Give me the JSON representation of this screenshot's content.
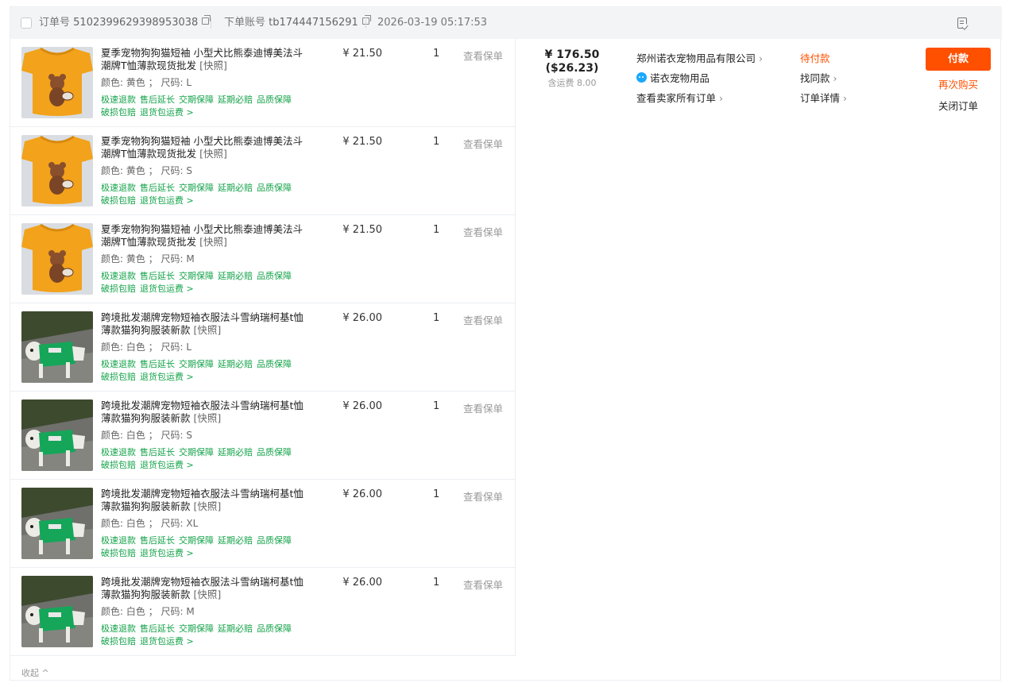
{
  "header": {
    "order_no_label": "订单号",
    "order_no": "5102399629398953038",
    "account_label": "下单账号",
    "account": "tb174447156291",
    "datetime": "2026-03-19 05:17:53"
  },
  "items": [
    {
      "title": "夏季宠物狗狗猫短袖 小型犬比熊泰迪博美法斗潮牌T恤薄款现货批发",
      "snapshot": "[快照]",
      "spec": "颜色: 黄色 ； 尺码: L",
      "price": "¥ 21.50",
      "qty": "1",
      "warranty": "查看保单",
      "image": "yellow-bear-shirt"
    },
    {
      "title": "夏季宠物狗狗猫短袖 小型犬比熊泰迪博美法斗潮牌T恤薄款现货批发",
      "snapshot": "[快照]",
      "spec": "颜色: 黄色 ； 尺码: S",
      "price": "¥ 21.50",
      "qty": "1",
      "warranty": "查看保单",
      "image": "yellow-bear-shirt"
    },
    {
      "title": "夏季宠物狗狗猫短袖 小型犬比熊泰迪博美法斗潮牌T恤薄款现货批发",
      "snapshot": "[快照]",
      "spec": "颜色: 黄色 ； 尺码: M",
      "price": "¥ 21.50",
      "qty": "1",
      "warranty": "查看保单",
      "image": "yellow-bear-shirt"
    },
    {
      "title": "跨境批发潮牌宠物短袖衣服法斗雪纳瑞柯基t恤薄款猫狗狗服装新款",
      "snapshot": "[快照]",
      "spec": "颜色: 白色 ； 尺码: L",
      "price": "¥ 26.00",
      "qty": "1",
      "warranty": "查看保单",
      "image": "dog-white-green-shirt"
    },
    {
      "title": "跨境批发潮牌宠物短袖衣服法斗雪纳瑞柯基t恤薄款猫狗狗服装新款",
      "snapshot": "[快照]",
      "spec": "颜色: 白色 ； 尺码: S",
      "price": "¥ 26.00",
      "qty": "1",
      "warranty": "查看保单",
      "image": "dog-white-green-shirt"
    },
    {
      "title": "跨境批发潮牌宠物短袖衣服法斗雪纳瑞柯基t恤薄款猫狗狗服装新款",
      "snapshot": "[快照]",
      "spec": "颜色: 白色 ； 尺码: XL",
      "price": "¥ 26.00",
      "qty": "1",
      "warranty": "查看保单",
      "image": "dog-white-green-shirt"
    },
    {
      "title": "跨境批发潮牌宠物短袖衣服法斗雪纳瑞柯基t恤薄款猫狗狗服装新款",
      "snapshot": "[快照]",
      "spec": "颜色: 白色 ； 尺码: M",
      "price": "¥ 26.00",
      "qty": "1",
      "warranty": "查看保单",
      "image": "dog-white-green-shirt"
    }
  ],
  "service_tags": [
    "极速退款",
    "售后延长",
    "交期保障",
    "延期必赔",
    "品质保障",
    "破损包赔",
    "退货包运费 >"
  ],
  "collapse_label": "收起 ^",
  "totals": {
    "rmb": "¥ 176.50",
    "usd": "($26.23)",
    "shipping": "含运费 8.00"
  },
  "seller": {
    "company": "郑州诺衣宠物用品有限公司",
    "shop": "诺衣宠物用品",
    "all_orders": "查看卖家所有订单"
  },
  "status": {
    "label": "待付款",
    "find_similar": "找同款",
    "detail": "订单详情"
  },
  "actions": {
    "pay": "付款",
    "rebuy": "再次购买",
    "close": "关闭订单"
  },
  "colors": {
    "accent": "#ff5000",
    "tag_green": "#15a34a",
    "header_bg": "#f3f4f6",
    "wangwang": "#1ba8ff"
  }
}
